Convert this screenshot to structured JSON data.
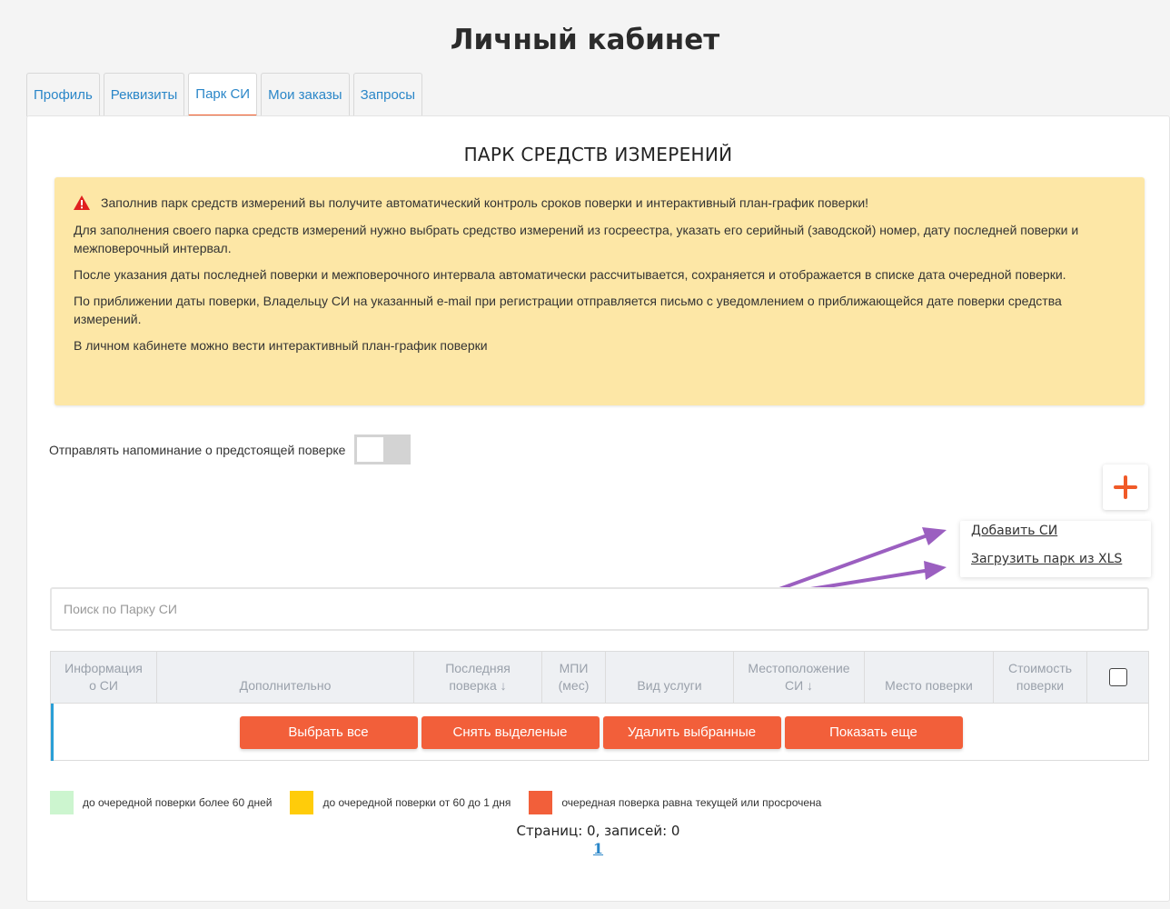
{
  "page_title": "Личный кабинет",
  "tabs": [
    {
      "label": "Профиль"
    },
    {
      "label": "Реквизиты"
    },
    {
      "label": "Парк СИ"
    },
    {
      "label": "Мои заказы"
    },
    {
      "label": "Запросы"
    }
  ],
  "section_title": "ПАРК СРЕДСТВ ИЗМЕРЕНИЙ",
  "notice": {
    "icon": "warning-icon",
    "lines": [
      "Заполнив парк средств измерений вы получите автоматический контроль сроков поверки и интерактивный план-график поверки!",
      "Для заполнения своего парка средств измерений нужно выбрать средство измерений из госреестра, указать его серийный (заводской) номер, дату последней поверки и межповерочный интервал.",
      "После указания даты последней поверки и межповерочного интервала автоматически рассчитывается, сохраняется и отображается в списке дата очередной поверки.",
      "По приближении даты поверки, Владельцу СИ на указанный e-mail при регистрации отправляется письмо с уведомлением о приближающейся дате поверки средства измерений.",
      "В личном кабинете можно вести интерактивный план-график поверки"
    ]
  },
  "reminder": {
    "label": "Отправлять напоминание о предстоящей поверке"
  },
  "menu": {
    "add": "Добавить СИ",
    "upload": "Загрузить парк из XLS"
  },
  "search": {
    "placeholder": "Поиск по Парку СИ"
  },
  "table": {
    "headers": [
      {
        "l1": "Информация",
        "l2": "о СИ"
      },
      {
        "l1": "",
        "l2": "Дополнительно"
      },
      {
        "l1": "Последняя",
        "l2": "поверка ↓"
      },
      {
        "l1": "МПИ",
        "l2": "(мес)"
      },
      {
        "l1": "",
        "l2": "Вид услуги"
      },
      {
        "l1": "Местоположение",
        "l2": "СИ ↓"
      },
      {
        "l1": "",
        "l2": "Место поверки"
      },
      {
        "l1": "Стоимость",
        "l2": "поверки"
      }
    ]
  },
  "buttons": {
    "select_all": "Выбрать все",
    "deselect": "Снять выделеные",
    "delete_selected": "Удалить выбранные",
    "show_more": "Показать еще"
  },
  "legend": [
    {
      "color": "#ccf5cf",
      "label": "до очередной поверки более 60 дней"
    },
    {
      "color": "#ffcc0a",
      "label": "до очередной поверки от 60 до 1 дня"
    },
    {
      "color": "#f25f3a",
      "label": "очередная поверка равна текущей или просрочена"
    }
  ],
  "pagination": {
    "info": "Страниц: 0, записей: 0",
    "page": "1"
  },
  "colors": {
    "accent": "#f05a28",
    "link": "#2a86c8",
    "notice_bg": "#fde7a6",
    "annotation_arrow": "#9b5fc0"
  }
}
